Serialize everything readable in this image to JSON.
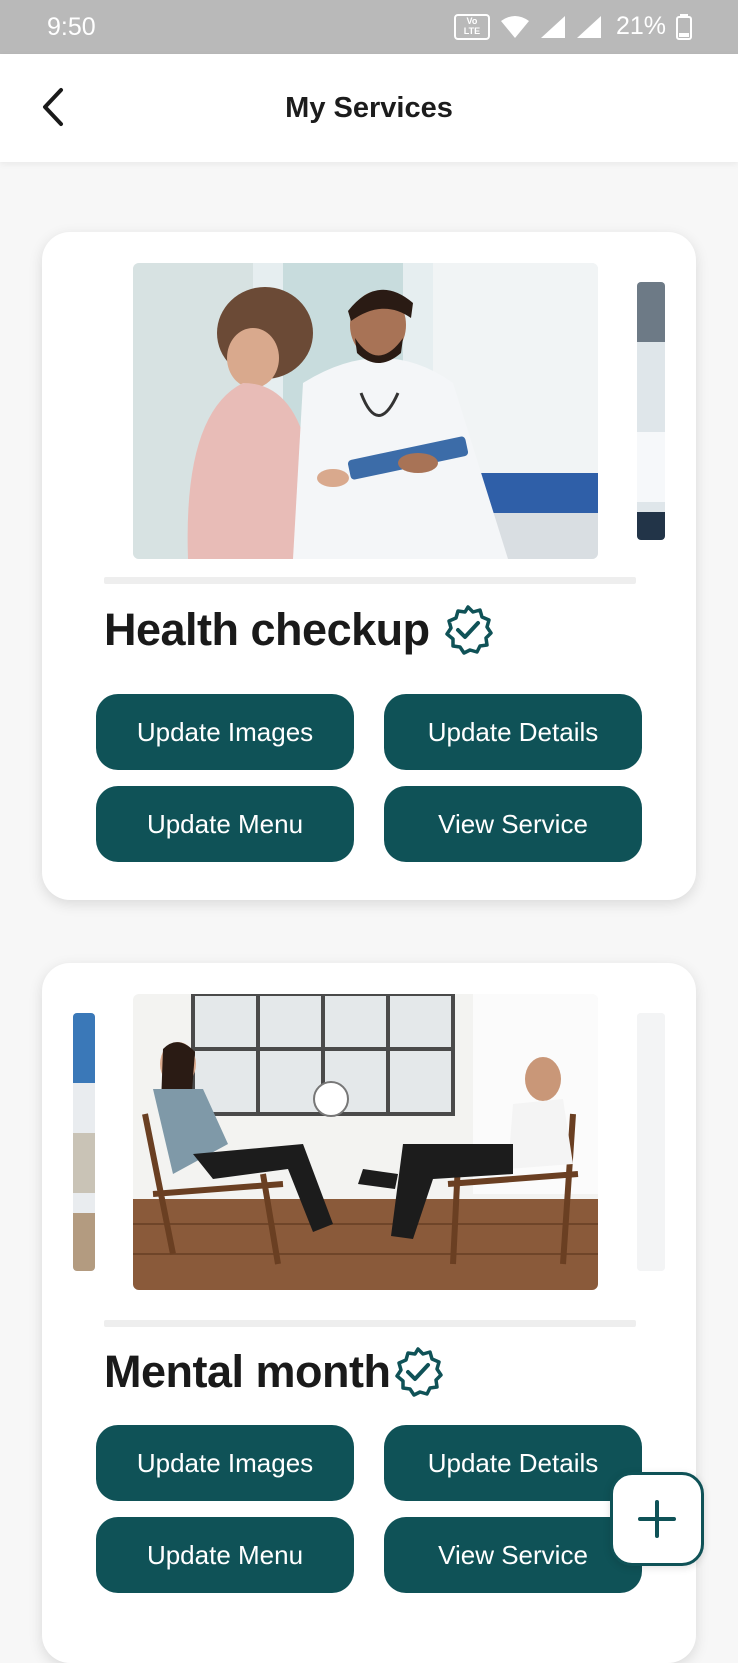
{
  "status_bar": {
    "time": "9:50",
    "volte_label_top": "Vo LTE",
    "battery_text": "21%"
  },
  "header": {
    "title": "My Services",
    "back_icon": "chevron-left-icon"
  },
  "services": [
    {
      "title": "Health checkup",
      "verified_icon": "verified-badge-icon",
      "buttons": {
        "update_images": "Update Images",
        "update_details": "Update Details",
        "update_menu": "Update Menu",
        "view_service": "View Service"
      }
    },
    {
      "title": "Mental month",
      "verified_icon": "verified-badge-icon",
      "buttons": {
        "update_images": "Update Images",
        "update_details": "Update Details",
        "update_menu": "Update Menu",
        "view_service": "View Service"
      }
    }
  ],
  "fab": {
    "icon": "plus-icon"
  },
  "colors": {
    "primary": "#0f5257",
    "status_bar": "#b9b9b9",
    "background": "#f7f7f7"
  }
}
